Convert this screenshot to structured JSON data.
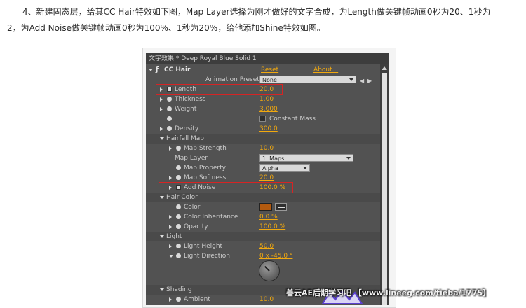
{
  "article": {
    "line1": "4、新建固态层，给其CC Hair特效如下图，Map Layer选择为刚才做好的文字合成，为Length做关键帧动画0秒为20、1秒为",
    "line2": "2，为Add Noise做关键帧动画0秒为100%、1秒为20%，给他添加Shine特效如图。"
  },
  "panel": {
    "title": "文字效果 * Deep Royal Blue Solid 1",
    "effect_name": "CC Hair",
    "reset_label": "Reset",
    "about_label": "About...",
    "animation_presets_label": "Animation Presets:",
    "animation_presets_value": "None",
    "params": {
      "length": {
        "label": "Length",
        "value": "20.0"
      },
      "thickness": {
        "label": "Thickness",
        "value": "1.00"
      },
      "weight": {
        "label": "Weight",
        "value": "3.000"
      },
      "constant_mass": {
        "label": "Constant Mass"
      },
      "density": {
        "label": "Density",
        "value": "300.0"
      },
      "hairfall_map": {
        "label": "Hairfall Map"
      },
      "map_strength": {
        "label": "Map Strength",
        "value": "10.0"
      },
      "map_layer": {
        "label": "Map Layer",
        "value": "1. Maps"
      },
      "map_property": {
        "label": "Map Property",
        "value": "Alpha"
      },
      "map_softness": {
        "label": "Map Softness",
        "value": "20.0"
      },
      "add_noise": {
        "label": "Add Noise",
        "value": "100.0 %"
      },
      "hair_color": {
        "label": "Hair Color"
      },
      "color": {
        "label": "Color",
        "swatch": "#b35a0f"
      },
      "color_inheritance": {
        "label": "Color Inheritance",
        "value": "0.0 %"
      },
      "opacity": {
        "label": "Opacity",
        "value": "100.0 %"
      },
      "light": {
        "label": "Light"
      },
      "light_height": {
        "label": "Light Height",
        "value": "50.0"
      },
      "light_direction": {
        "label": "Light Direction",
        "value": "0 x -45.0 °"
      },
      "shading": {
        "label": "Shading"
      },
      "ambient": {
        "label": "Ambient",
        "value": "10.0"
      }
    }
  },
  "watermark": {
    "text": "善云AE后期学习吧 【www.lineeg.com/tieba/1775】"
  },
  "colors": {
    "panel_bg": "#525252",
    "value_orange": "#f2a90e",
    "highlight_red": "#d62424"
  }
}
